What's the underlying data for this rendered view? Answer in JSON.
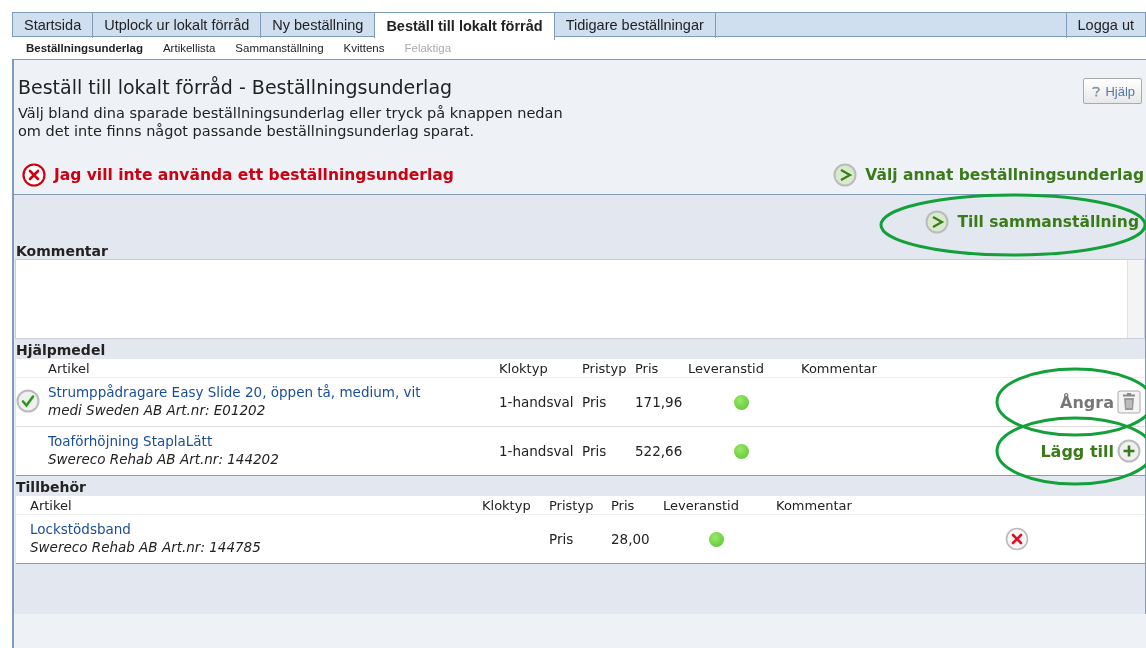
{
  "tabs": [
    {
      "label": "Startsida",
      "selected": false
    },
    {
      "label": "Utplock ur lokalt förråd",
      "selected": false
    },
    {
      "label": "Ny beställning",
      "selected": false
    },
    {
      "label": "Beställ till lokalt förråd",
      "selected": true
    },
    {
      "label": "Tidigare beställningar",
      "selected": false
    }
  ],
  "logout": "Logga ut",
  "subtabs": [
    {
      "label": "Beställningsunderlag",
      "selected": true,
      "disabled": false
    },
    {
      "label": "Artikellista",
      "selected": false,
      "disabled": false
    },
    {
      "label": "Sammanställning",
      "selected": false,
      "disabled": false
    },
    {
      "label": "Kvittens",
      "selected": false,
      "disabled": false
    },
    {
      "label": "Felaktiga",
      "selected": false,
      "disabled": true
    }
  ],
  "page": {
    "title": "Beställ till lokalt förråd - Beställningsunderlag",
    "description": "Välj bland dina sparade beställningsunderlag eller tryck på knappen nedan om det inte finns något passande beställningsunderlag sparat.",
    "help": "Hjälp"
  },
  "decline_action": {
    "label": "Jag vill inte använda ett beställningsunderlag"
  },
  "choose_action": {
    "label": "Välj annat beställningsunderlag"
  },
  "summary_action": {
    "label": "Till sammanställning",
    "circled": true
  },
  "comment": {
    "label": "Kommentar"
  },
  "sections": [
    {
      "title": "Hjälpmedel",
      "kind": "aids",
      "columns": [
        "Artikel",
        "Kloktyp",
        "Pristyp",
        "Pris",
        "Leveranstid",
        "Kommentar"
      ],
      "rows": [
        {
          "checked": true,
          "name": "Strumppådragare Easy Slide 20, öppen tå, medium, vit",
          "supplier": "medi Sweden AB  Art.nr: E01202",
          "kloktyp": "1-handsval",
          "pristyp": "Pris",
          "price": "171,96",
          "action": {
            "kind": "undo",
            "label": "Ångra",
            "circled": true
          }
        },
        {
          "checked": false,
          "name": "Toaförhöjning StaplaLätt",
          "supplier": "Swereco Rehab AB  Art.nr: 144202",
          "kloktyp": "1-handsval",
          "pristyp": "Pris",
          "price": "522,66",
          "action": {
            "kind": "add",
            "label": "Lägg till",
            "circled": true
          }
        }
      ]
    },
    {
      "title": "Tillbehör",
      "kind": "accessories",
      "columns": [
        "Artikel",
        "Kloktyp",
        "Pristyp",
        "Pris",
        "Leveranstid",
        "Kommentar"
      ],
      "rows": [
        {
          "checked": false,
          "name": "Lockstödsband",
          "supplier": "Swereco Rehab AB  Art.nr: 144785",
          "pristyp": "Pris",
          "price": "28,00",
          "action": {
            "kind": "remove",
            "circled": false
          }
        }
      ]
    }
  ]
}
